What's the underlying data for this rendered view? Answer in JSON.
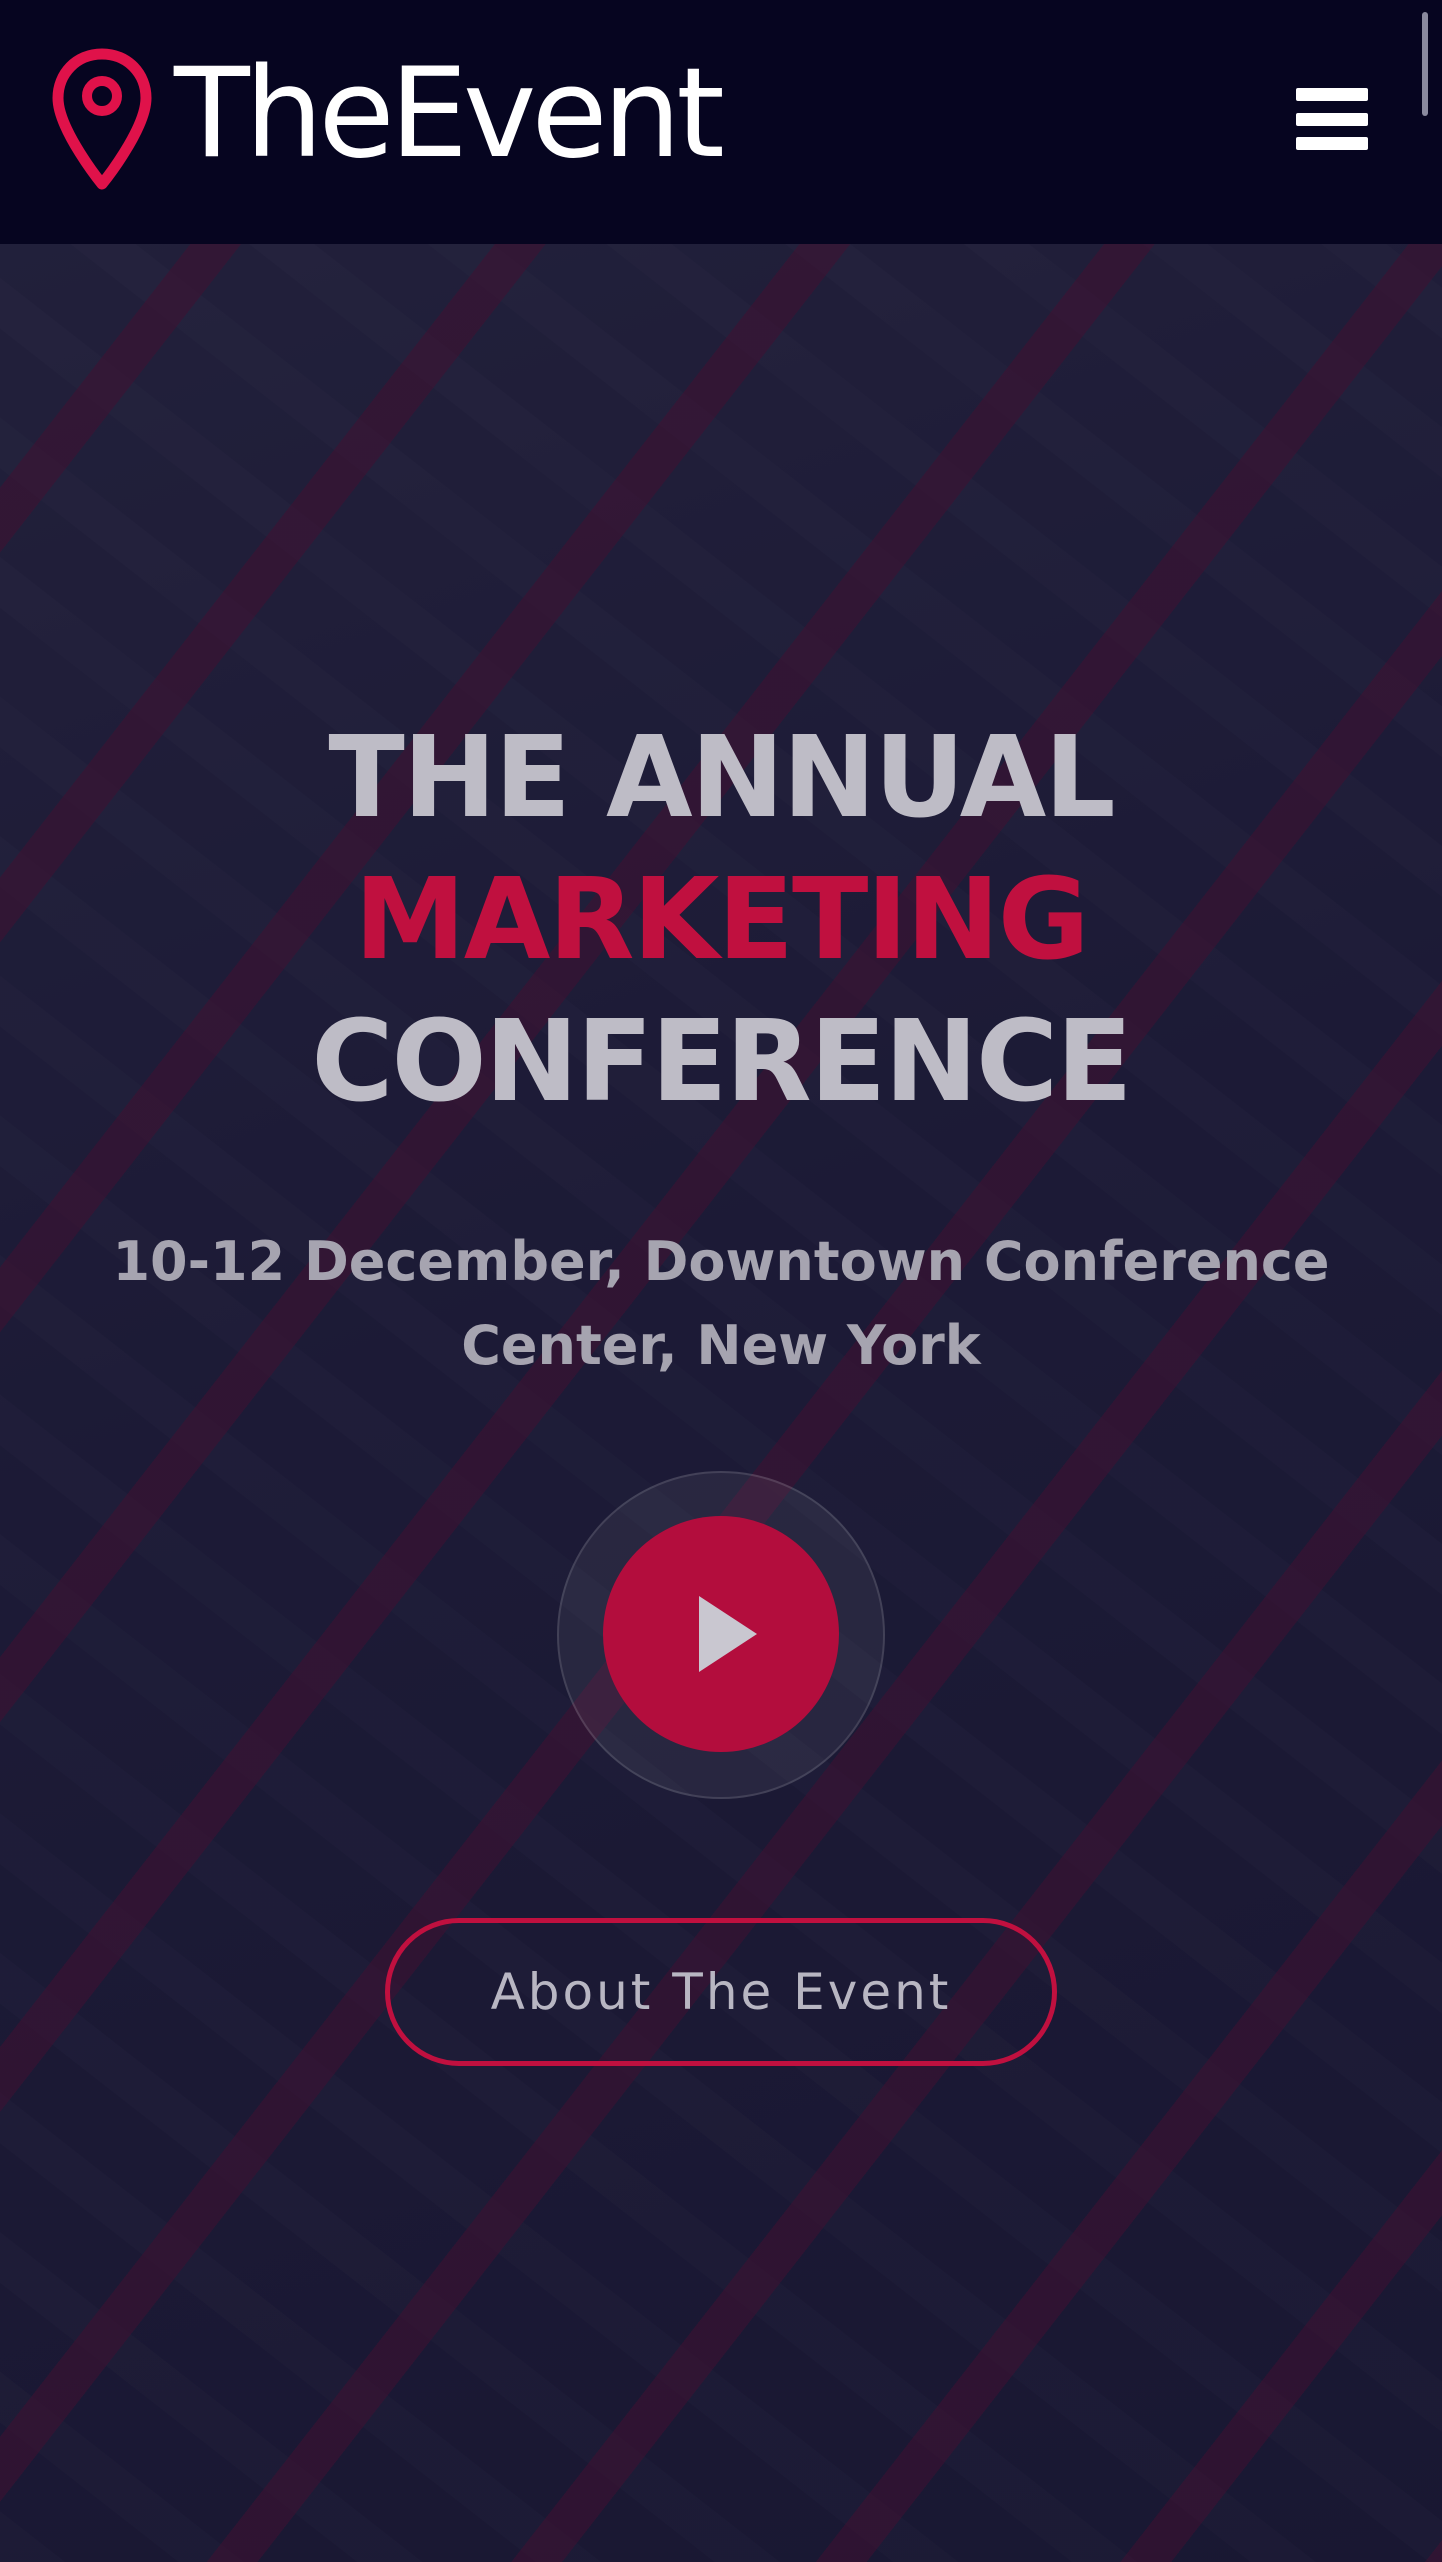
{
  "header": {
    "logo_text": "TheEvent",
    "logo_icon": "map-pin-icon",
    "menu_icon": "hamburger-menu-icon"
  },
  "hero": {
    "background_image": "conference audience photo",
    "headline_line1": "THE ANNUAL",
    "headline_line2": "MARKETING",
    "headline_line3": "CONFERENCE",
    "subtitle": "10-12 December, Downtown Conference Center, New York",
    "play_icon": "play-icon",
    "about_button_label": "About The Event"
  },
  "colors": {
    "accent": "#c0103f",
    "header_bg": "#060520",
    "text_light": "#bebcc6"
  }
}
